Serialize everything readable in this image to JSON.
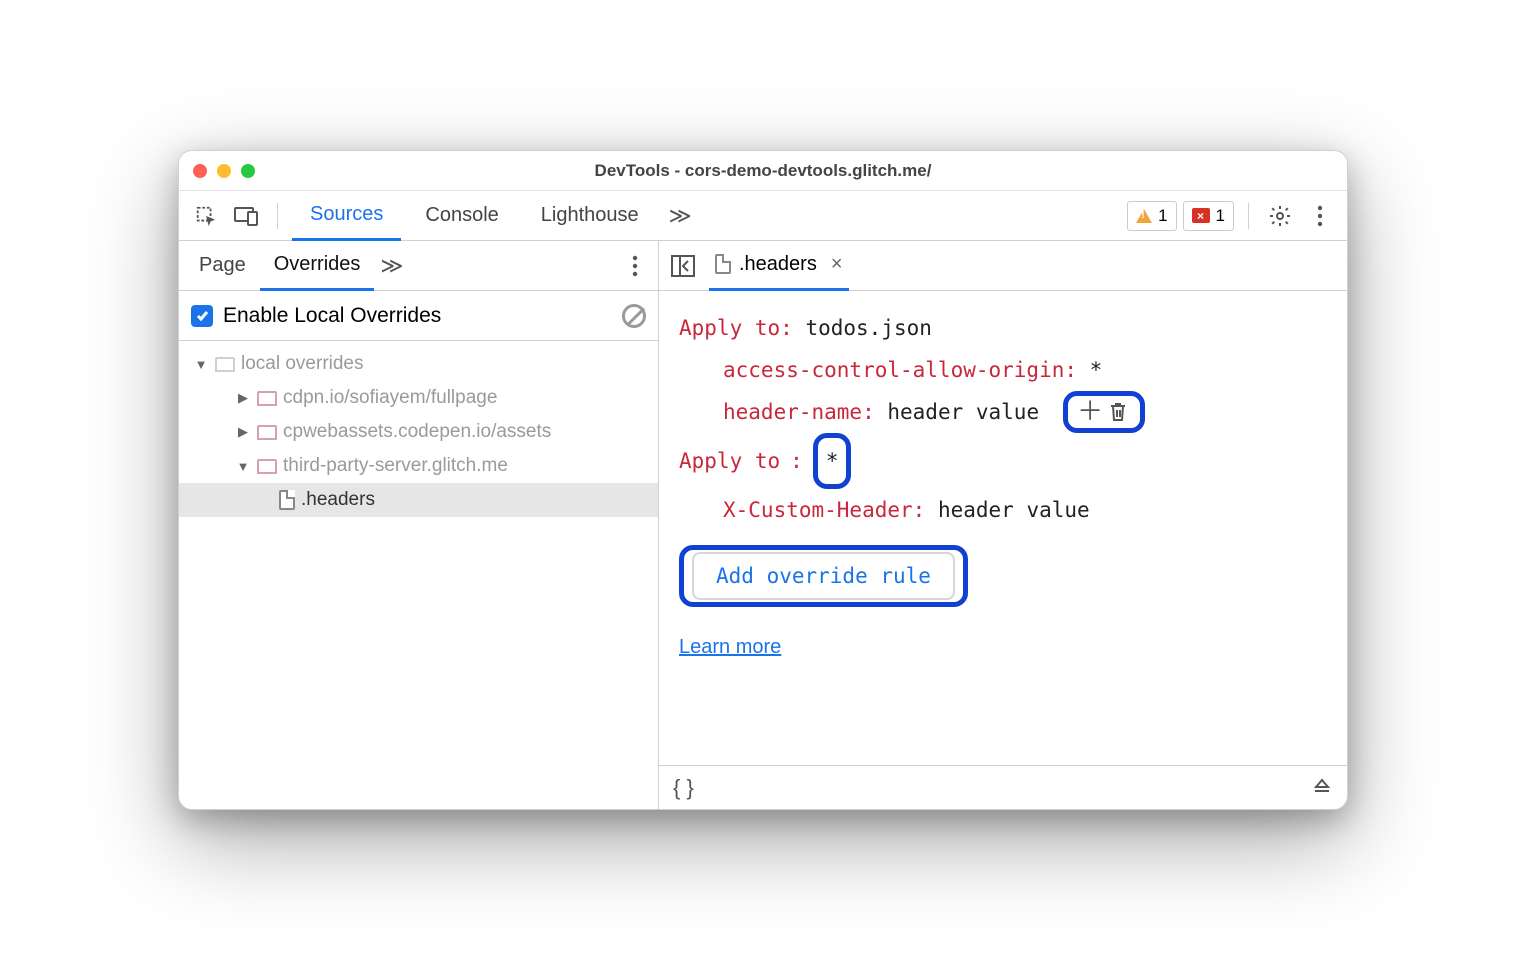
{
  "window": {
    "title": "DevTools - cors-demo-devtools.glitch.me/"
  },
  "toolbar": {
    "tabs": [
      "Sources",
      "Console",
      "Lighthouse"
    ],
    "warning_count": "1",
    "error_count": "1"
  },
  "left": {
    "tabs": [
      "Page",
      "Overrides"
    ],
    "enable_label": "Enable Local Overrides",
    "tree": {
      "root": "local overrides",
      "folders": [
        "cdpn.io/sofiayem/fullpage",
        "cpwebassets.codepen.io/assets",
        "third-party-server.glitch.me"
      ],
      "file": ".headers"
    }
  },
  "editor": {
    "filename": ".headers",
    "rules": [
      {
        "apply_label": "Apply to",
        "target": "todos.json",
        "headers": [
          {
            "name": "access-control-allow-origin",
            "value": "*"
          },
          {
            "name": "header-name",
            "value": "header value"
          }
        ]
      },
      {
        "apply_label": "Apply to",
        "target": "*",
        "headers": [
          {
            "name": "X-Custom-Header",
            "value": "header value"
          }
        ]
      }
    ],
    "add_rule_label": "Add override rule",
    "learn_more": "Learn more"
  }
}
